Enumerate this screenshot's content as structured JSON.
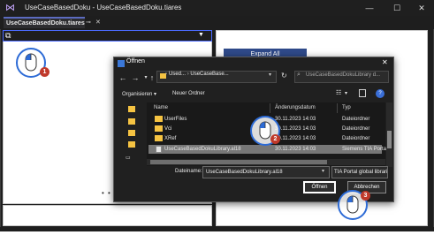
{
  "window": {
    "title": "UseCaseBasedDoku - UseCaseBasedDoku.tiares",
    "tab_label": "UseCaseBasedDoku.tiares",
    "expand_all_label": "Expand All"
  },
  "dialog": {
    "title": "Öffnen",
    "address_segments": [
      "Used...",
      "UseCaseBase..."
    ],
    "search_placeholder": "UseCaseBasedDokuLibrary d...",
    "organize_label": "Organisieren ▾",
    "new_folder_label": "Neuer Ordner",
    "columns": {
      "name": "Name",
      "date": "Änderungsdatum",
      "type": "Typ"
    },
    "files": [
      {
        "name": "UserFiles",
        "date": "30.11.2023 14:03",
        "type": "Dateiordner",
        "kind": "folder",
        "selected": false
      },
      {
        "name": "Vci",
        "date": "30.11.2023 14:03",
        "type": "Dateiordner",
        "kind": "folder",
        "selected": false
      },
      {
        "name": "XRef",
        "date": "30.11.2023 14:03",
        "type": "Dateiordner",
        "kind": "folder",
        "selected": false
      },
      {
        "name": "UseCaseBasedDokuLibrary.al18",
        "date": "30.11.2023 14:03",
        "type": "Siemens TIA Portal",
        "kind": "file",
        "selected": true
      }
    ],
    "filename_label": "Dateiname:",
    "filename_value": "UseCaseBasedDokuLibrary.al18",
    "filetype_value": "TIA Portal global libraries  (*.al*",
    "open_label": "Öffnen",
    "cancel_label": "Abbrechen"
  },
  "callouts": [
    "1",
    "2",
    "3"
  ],
  "colors": {
    "accent_blue": "#2d6bd6",
    "badge_red": "#c0392b",
    "folder_yellow": "#f5c342"
  }
}
